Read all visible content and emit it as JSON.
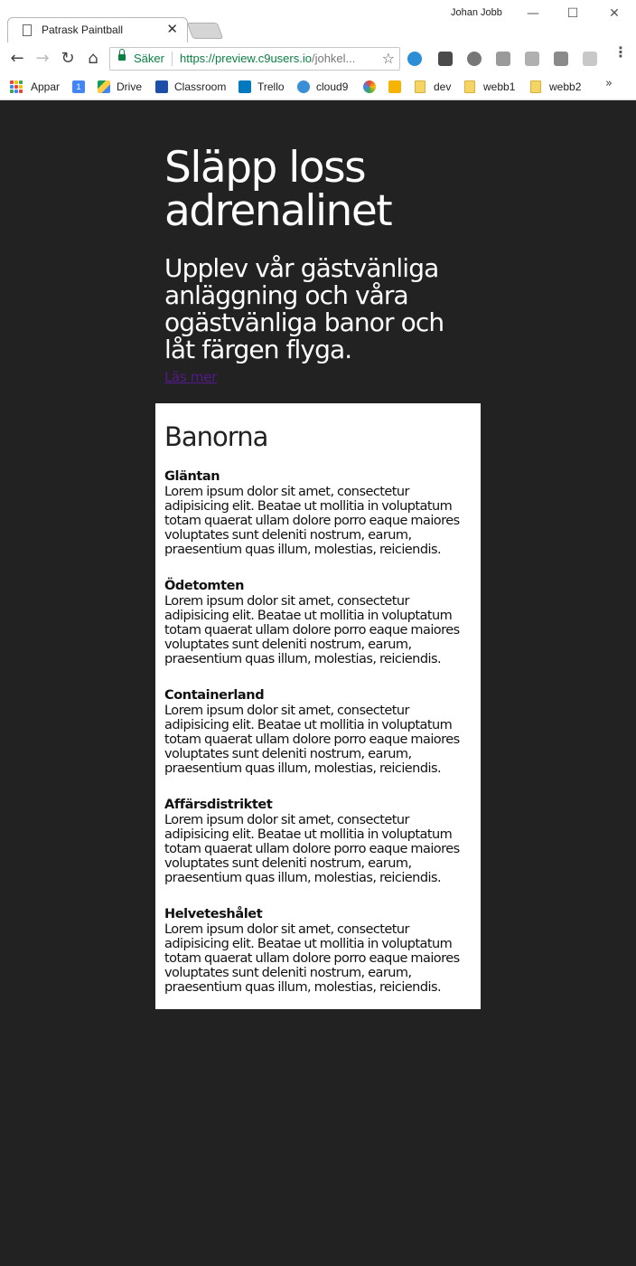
{
  "browser": {
    "tab_title": "Patrask Paintball",
    "tab_close": "✕",
    "profile_name": "Johan Jobb",
    "window": {
      "minimize": "—",
      "maximize": "☐",
      "close": "✕"
    },
    "nav": {
      "back": "←",
      "forward": "→",
      "reload": "↻",
      "home": "⌂"
    },
    "address": {
      "secure_label": "Säker",
      "url_scheme_host": "https://preview.c9users.io",
      "url_rest": "/johkel..."
    },
    "star": "☆",
    "menu": "⋮",
    "bookmarks": [
      {
        "label": "Appar",
        "icon": "apps-grid-icon"
      },
      {
        "label": "",
        "icon": "calendar-icon"
      },
      {
        "label": "Drive",
        "icon": "drive-icon"
      },
      {
        "label": "Classroom",
        "icon": "classroom-icon"
      },
      {
        "label": "Trello",
        "icon": "trello-icon"
      },
      {
        "label": "cloud9",
        "icon": "cloud9-icon"
      },
      {
        "label": "",
        "icon": "pinwheel-icon"
      },
      {
        "label": "",
        "icon": "keep-icon"
      },
      {
        "label": "dev",
        "icon": "folder-icon"
      },
      {
        "label": "webb1",
        "icon": "folder-icon"
      },
      {
        "label": "webb2",
        "icon": "folder-icon"
      }
    ],
    "bookmarks_overflow": "»",
    "calendar_day": "1"
  },
  "hero": {
    "title": "Släpp loss adrenalinet",
    "subtitle": "Upplev vår gästvänliga anläggning och våra ogästvänliga banor och låt färgen flyga.",
    "read_more": "Läs mer"
  },
  "courses": {
    "heading": "Banorna",
    "items": [
      {
        "name": "Gläntan",
        "text": "Lorem ipsum dolor sit amet, consectetur adipisicing elit. Beatae ut mollitia in voluptatum totam quaerat ullam dolore porro eaque maiores voluptates sunt deleniti nostrum, earum, praesentium quas illum, molestias, reiciendis."
      },
      {
        "name": "Ödetomten",
        "text": "Lorem ipsum dolor sit amet, consectetur adipisicing elit. Beatae ut mollitia in voluptatum totam quaerat ullam dolore porro eaque maiores voluptates sunt deleniti nostrum, earum, praesentium quas illum, molestias, reiciendis."
      },
      {
        "name": "Containerland",
        "text": "Lorem ipsum dolor sit amet, consectetur adipisicing elit. Beatae ut mollitia in voluptatum totam quaerat ullam dolore porro eaque maiores voluptates sunt deleniti nostrum, earum, praesentium quas illum, molestias, reiciendis."
      },
      {
        "name": "Affärsdistriktet",
        "text": "Lorem ipsum dolor sit amet, consectetur adipisicing elit. Beatae ut mollitia in voluptatum totam quaerat ullam dolore porro eaque maiores voluptates sunt deleniti nostrum, earum, praesentium quas illum, molestias, reiciendis."
      },
      {
        "name": "Helveteshålet",
        "text": "Lorem ipsum dolor sit amet, consectetur adipisicing elit. Beatae ut mollitia in voluptatum totam quaerat ullam dolore porro eaque maiores voluptates sunt deleniti nostrum, earum, praesentium quas illum, molestias, reiciendis."
      }
    ]
  },
  "colors": {
    "page_background": "#222222",
    "panel_background": "#ffffff",
    "secure_green": "#0b8043",
    "visited_link": "#551a8b"
  }
}
